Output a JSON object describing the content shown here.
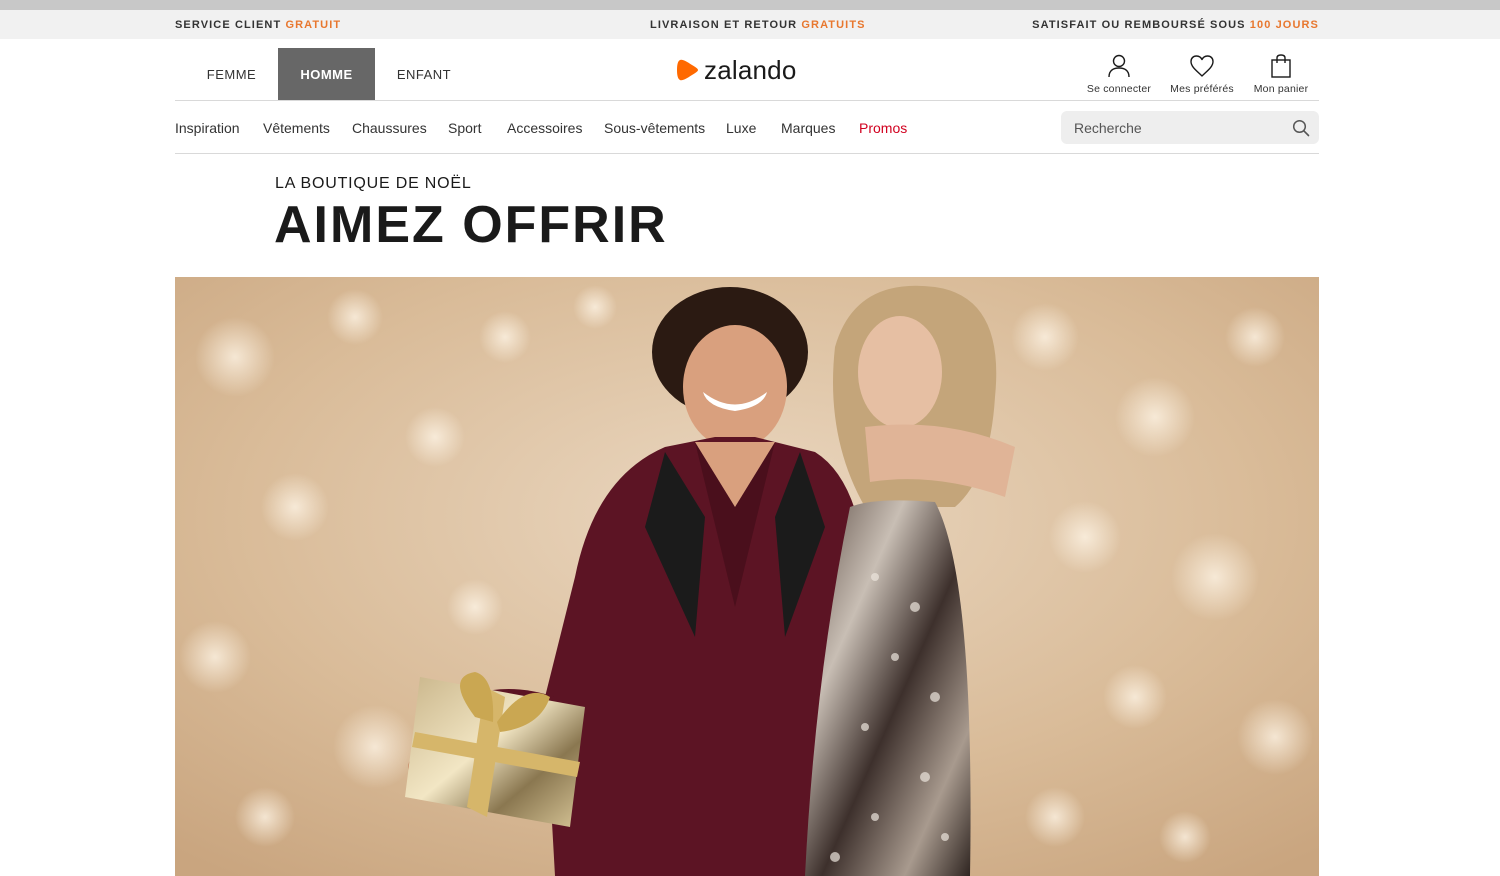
{
  "promo_bar": {
    "left_text": "SERVICE CLIENT ",
    "left_highlight": "GRATUIT",
    "center_text": "LIVRAISON ET RETOUR ",
    "center_highlight": "GRATUITS",
    "right_text": "SATISFAIT OU REMBOURSÉ SOUS ",
    "right_highlight": "100 JOURS",
    "highlight_color": "#e8772e"
  },
  "header": {
    "gender_tabs": [
      {
        "label": "FEMME",
        "active": false
      },
      {
        "label": "HOMME",
        "active": true
      },
      {
        "label": "ENFANT",
        "active": false
      }
    ],
    "logo_text": "zalando",
    "logo_icon": "zalando-play-icon",
    "brand_color": "#ff6900",
    "actions": {
      "login": {
        "label": "Se connecter",
        "icon": "user-icon"
      },
      "favorites": {
        "label": "Mes préférés",
        "icon": "heart-icon"
      },
      "cart": {
        "label": "Mon panier",
        "icon": "shopping-bag-icon"
      }
    }
  },
  "category_nav": {
    "items": [
      "Inspiration",
      "Vêtements",
      "Chaussures",
      "Sport",
      "Accessoires",
      "Sous-vêtements",
      "Luxe",
      "Marques",
      "Promos"
    ],
    "promo_color": "#d1001f"
  },
  "search": {
    "placeholder": "Recherche",
    "icon": "search-icon"
  },
  "hero": {
    "subtitle": "LA BOUTIQUE DE NOËL",
    "title": "AIMEZ OFFRIR"
  }
}
